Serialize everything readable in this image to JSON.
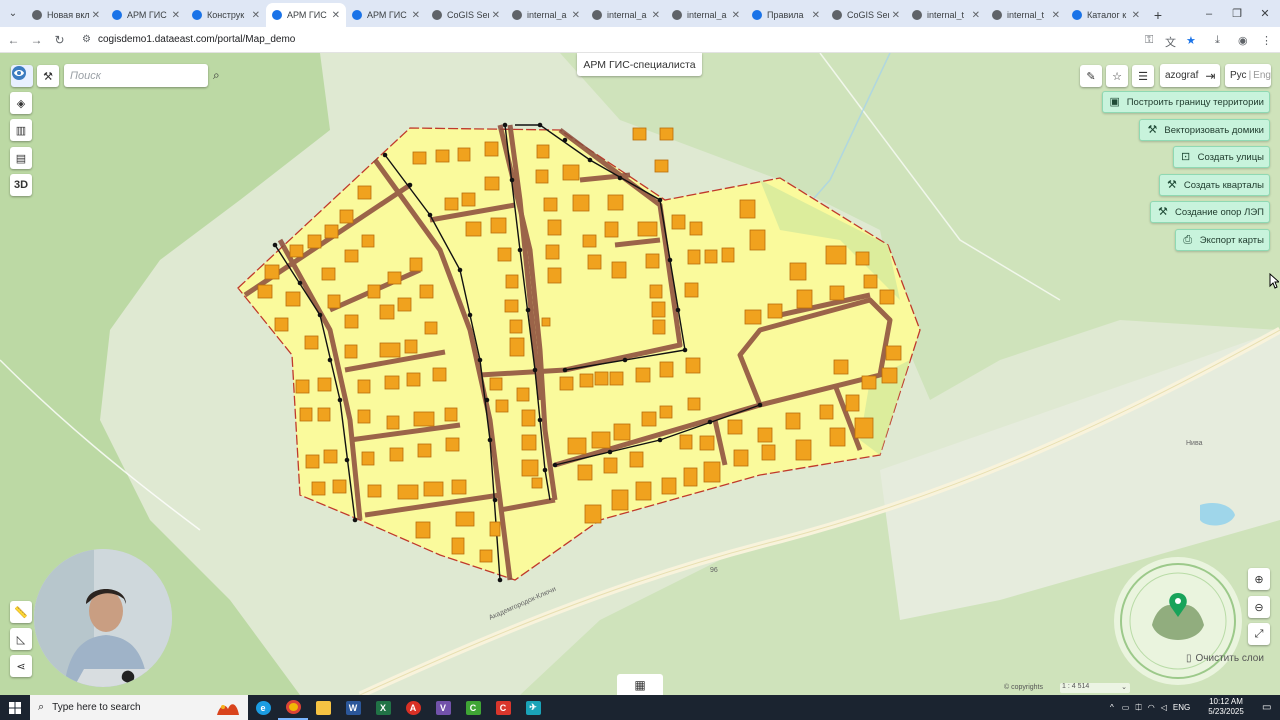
{
  "browser": {
    "tabs": [
      {
        "label": "Новая вкл",
        "color": "#5f6368"
      },
      {
        "label": "АРМ ГИС",
        "color": "#1a73e8"
      },
      {
        "label": "Конструк",
        "color": "#1a73e8"
      },
      {
        "label": "АРМ ГИС",
        "color": "#1a73e8"
      },
      {
        "label": "АРМ ГИС",
        "color": "#1a73e8"
      },
      {
        "label": "CoGIS Ser",
        "color": "#5f6368"
      },
      {
        "label": "internal_a",
        "color": "#5f6368"
      },
      {
        "label": "internal_a",
        "color": "#5f6368"
      },
      {
        "label": "internal_a",
        "color": "#5f6368"
      },
      {
        "label": "Правила",
        "color": "#1a73e8"
      },
      {
        "label": "CoGIS Ser",
        "color": "#5f6368"
      },
      {
        "label": "internal_t",
        "color": "#5f6368"
      },
      {
        "label": "internal_t",
        "color": "#5f6368"
      },
      {
        "label": "Каталог к",
        "color": "#1a73e8"
      }
    ],
    "active_tab_index": 3,
    "url": "cogisdemo1.dataeast.com/portal/Map_demo"
  },
  "app": {
    "title": "АРМ ГИС-специалиста",
    "search_placeholder": "Поиск",
    "btn_3d": "3D",
    "user": "azograf",
    "lang_ru": "Рус",
    "lang_sep": "|",
    "lang_en": "Eng",
    "actions": [
      {
        "label": "Построить границу территории",
        "icon": "polygon-icon"
      },
      {
        "label": "Векторизовать домики",
        "icon": "tools-icon"
      },
      {
        "label": "Создать улицы",
        "icon": "street-icon"
      },
      {
        "label": "Создать кварталы",
        "icon": "tools-icon"
      },
      {
        "label": "Создание опор ЛЭП",
        "icon": "tools-icon"
      },
      {
        "label": "Экспорт карты",
        "icon": "export-icon"
      }
    ],
    "clear_layers": "Очистить слои",
    "copyright": "© copyrights",
    "scale": "1 : 4 514"
  },
  "map_labels": {
    "niva": "Нива",
    "road": "Академгородок-Ключи",
    "num": "96"
  },
  "taskbar": {
    "search_placeholder": "Type here to search",
    "lang": "ENG",
    "time": "10:12 AM",
    "date": "5/23/2025"
  }
}
